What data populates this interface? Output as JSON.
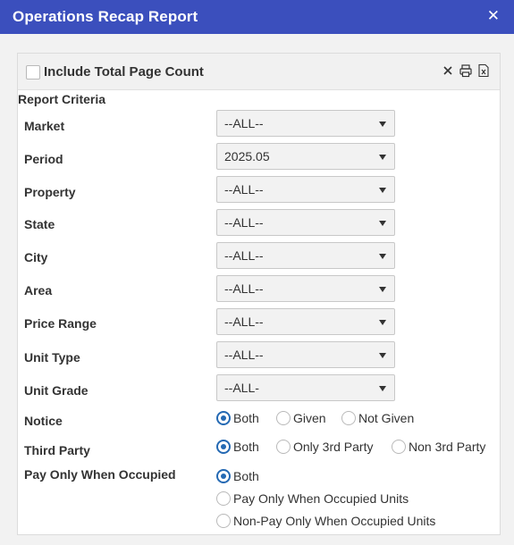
{
  "window": {
    "title": "Operations Recap Report",
    "close_glyph": "✕"
  },
  "panel": {
    "include_total_page_count_label": "Include Total Page Count",
    "include_total_page_count_checked": false,
    "icons": [
      "close-icon",
      "print-icon",
      "excel-icon"
    ]
  },
  "criteria": {
    "title": "Report Criteria",
    "fields": [
      {
        "label": "Market",
        "value": "--ALL--"
      },
      {
        "label": "Period",
        "value": "2025.05"
      },
      {
        "label": "Property",
        "value": "--ALL--"
      },
      {
        "label": "State",
        "value": "--ALL--"
      },
      {
        "label": "City",
        "value": "--ALL--"
      },
      {
        "label": "Area",
        "value": "--ALL--"
      },
      {
        "label": "Price Range",
        "value": "--ALL--"
      },
      {
        "label": "Unit Type",
        "value": "--ALL--"
      },
      {
        "label": "Unit Grade",
        "value": "--ALL-"
      }
    ],
    "notice": {
      "label": "Notice",
      "options": [
        "Both",
        "Given",
        "Not Given"
      ],
      "selected": "Both"
    },
    "third_party": {
      "label": "Third Party",
      "options": [
        "Both",
        "Only 3rd Party",
        "Non 3rd Party"
      ],
      "selected": "Both"
    },
    "pay_only": {
      "label": "Pay Only When Occupied",
      "options": [
        "Both",
        "Pay Only When Occupied Units",
        "Non-Pay Only When Occupied Units"
      ],
      "selected": "Both"
    }
  },
  "colors": {
    "titlebar": "#3b4fbd",
    "radio_selected": "#2469b3"
  }
}
